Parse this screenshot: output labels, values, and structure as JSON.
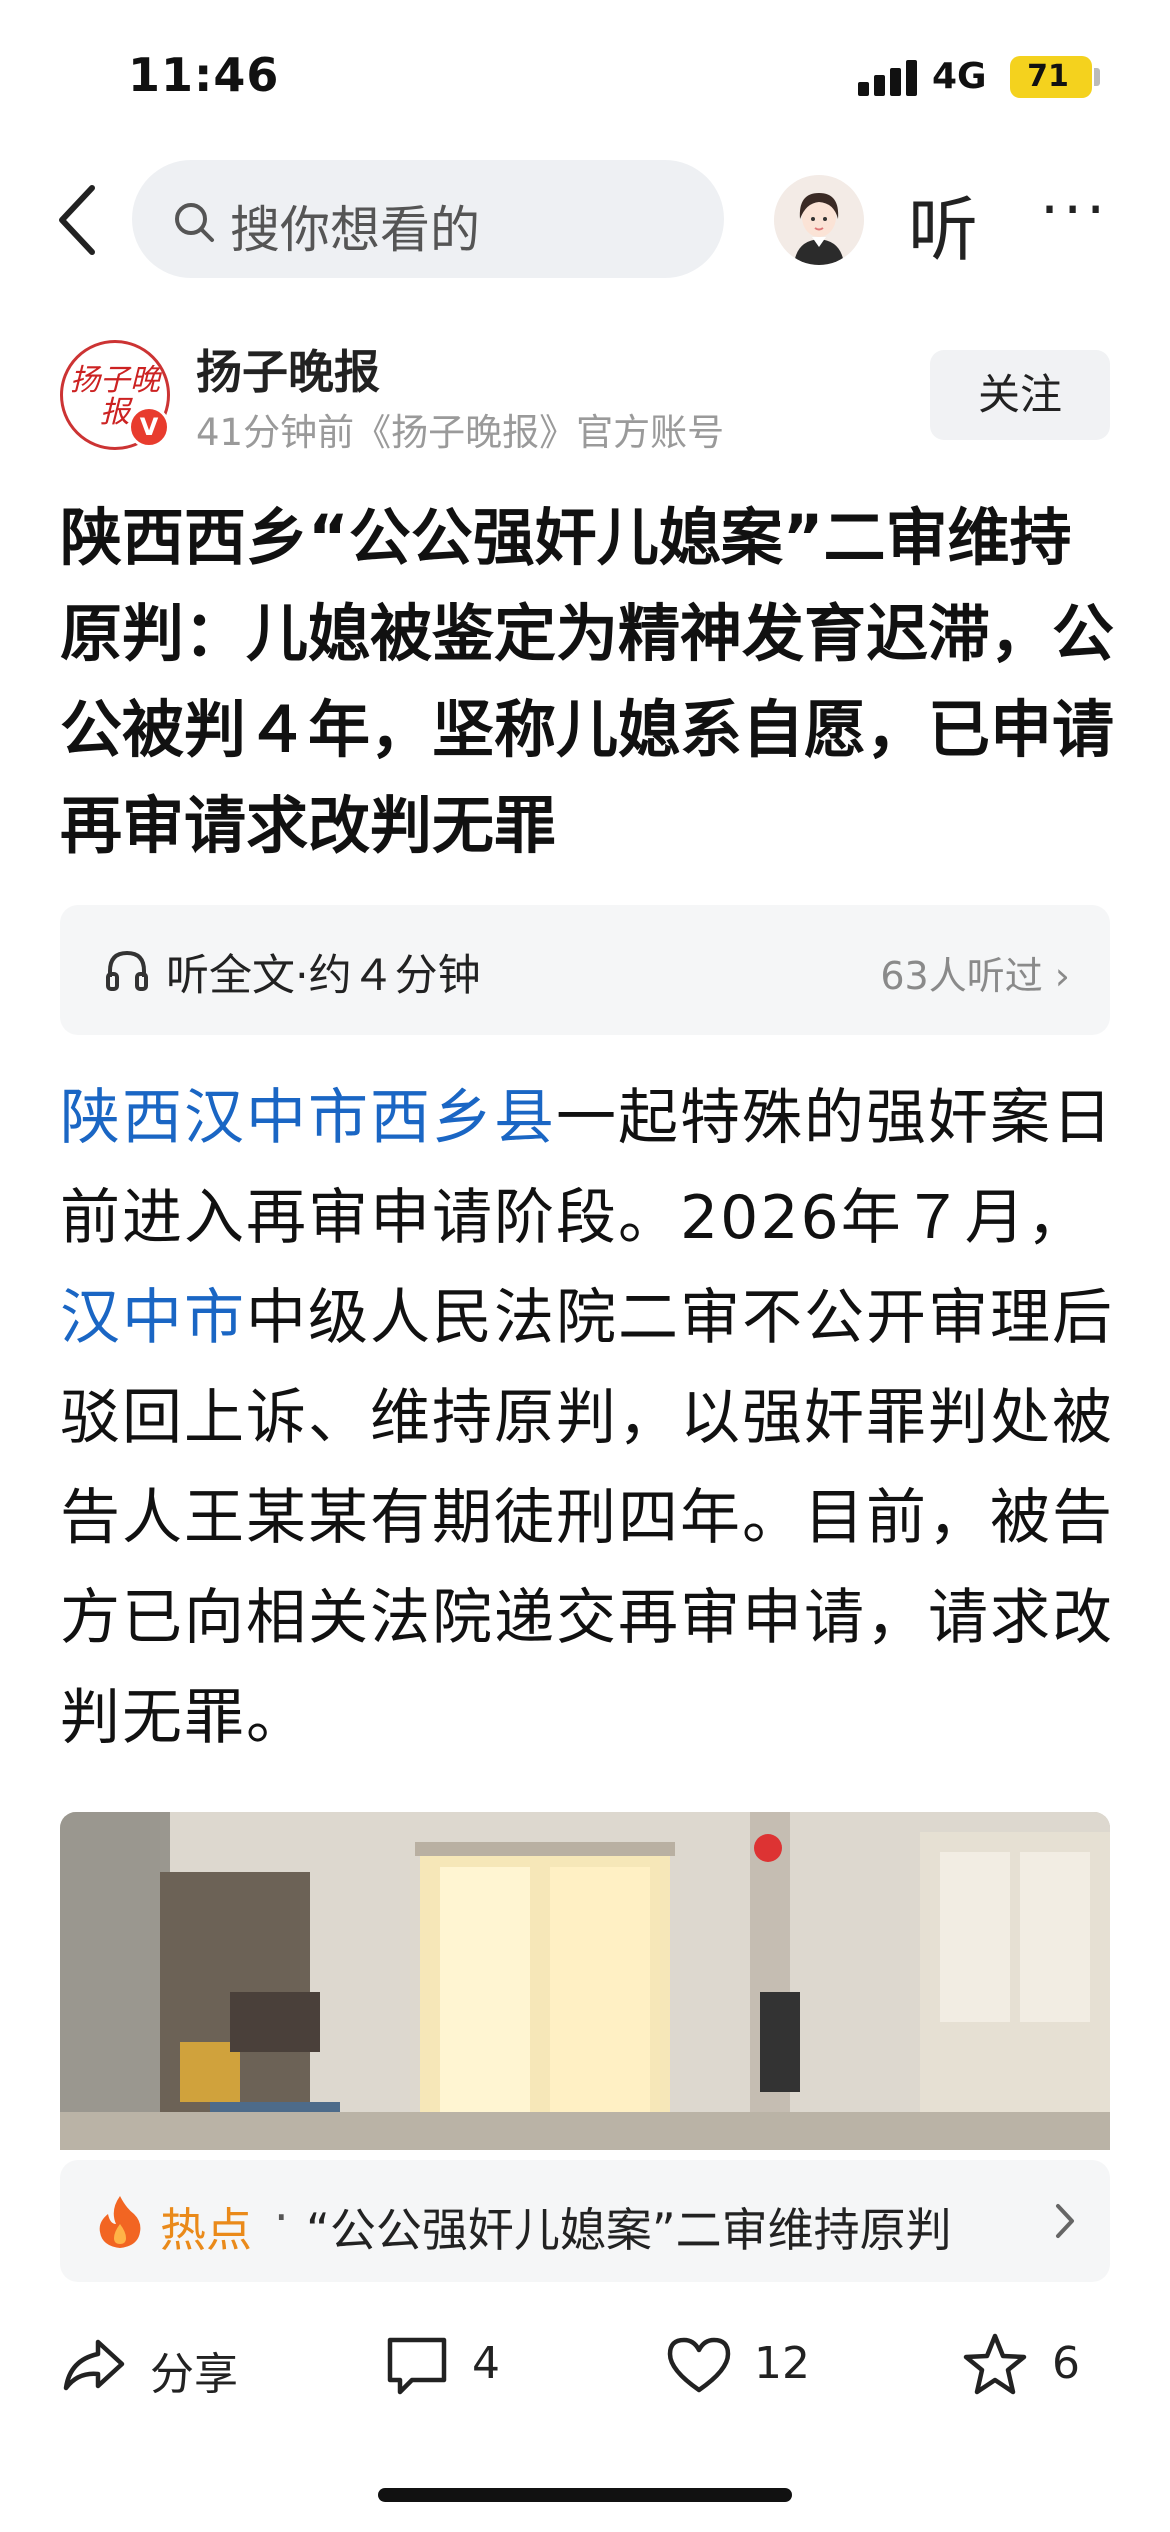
{
  "status_bar": {
    "time": "11:46",
    "network": "4G",
    "battery": "71",
    "battery_color": "#f4d21e"
  },
  "nav": {
    "search_placeholder": "搜你想看的",
    "listen_label": "听",
    "more_label": "···"
  },
  "author": {
    "logo_text": "扬子晚报",
    "name": "扬子晚报",
    "meta": "41分钟前《扬子晚报》官方账号",
    "verified": "V",
    "follow_label": "关注"
  },
  "article": {
    "title": "陕西西乡“公公强奸儿媳案”二审维持原判：儿媳被鉴定为精神发育迟滞，公公被判４年，坚称儿媳系自愿，已申请再审请求改判无罪",
    "listen_bar": {
      "label": "听全文·约４分钟",
      "count": "63人听过 ›"
    },
    "body": {
      "link1": "陕西汉中市西乡县",
      "text1": "一起特殊的强奸案日前进入再审申请阶段。2026年７月，",
      "link2": "汉中市",
      "text2": "中级人民法院二审不公开审理后驳回上诉、维持原判，以强奸罪判处被告人王某某有期徒刑四年。目前，被告方已向相关法院递交再审申请，请求改判无罪。"
    },
    "link_color": "#1a66c4"
  },
  "hot": {
    "label": "热点",
    "separator": "·",
    "title": "“公公强奸儿媳案”二审维持原判",
    "label_color": "#ea8a1a"
  },
  "actions": {
    "share": "分享",
    "comments": "4",
    "likes": "12",
    "favorites": "6"
  }
}
